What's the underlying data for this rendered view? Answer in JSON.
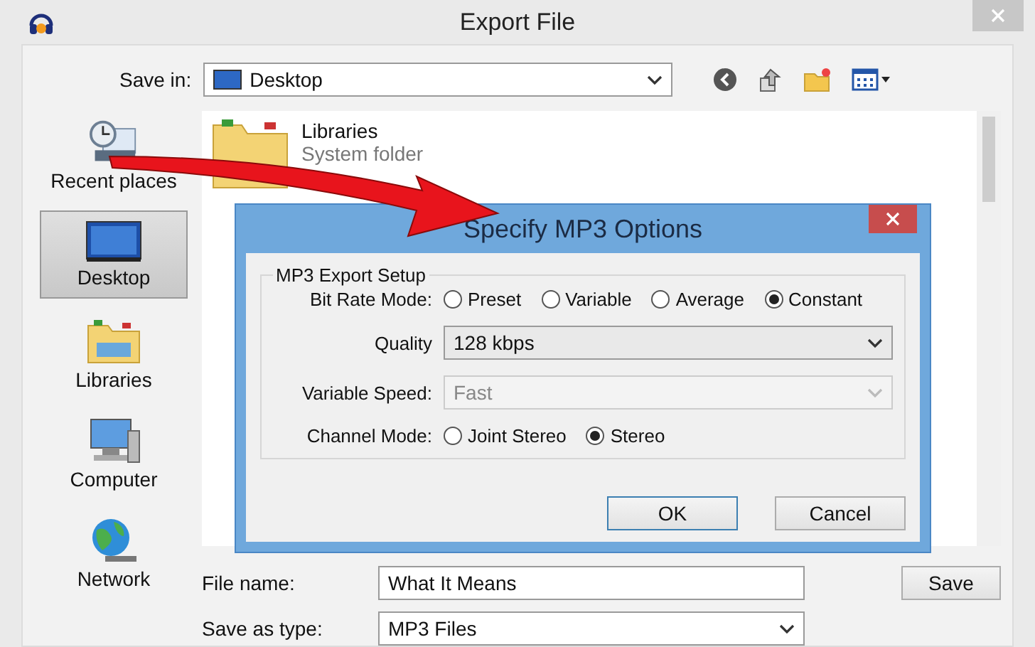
{
  "window": {
    "title": "Export File"
  },
  "save_in": {
    "label": "Save in:",
    "value": "Desktop"
  },
  "places": [
    {
      "label": "Recent places",
      "kind": "recent",
      "selected": false
    },
    {
      "label": "Desktop",
      "kind": "desktop",
      "selected": true
    },
    {
      "label": "Libraries",
      "kind": "libraries",
      "selected": false
    },
    {
      "label": "Computer",
      "kind": "computer",
      "selected": false
    },
    {
      "label": "Network",
      "kind": "network",
      "selected": false
    }
  ],
  "files": [
    {
      "name": "Libraries",
      "detail": "System folder"
    }
  ],
  "file_name": {
    "label": "File name:",
    "value": "What It Means"
  },
  "save_as_type": {
    "label": "Save as type:",
    "value": "MP3 Files"
  },
  "save_button": "Save",
  "dialog": {
    "title": "Specify MP3 Options",
    "group": "MP3 Export Setup",
    "bit_rate": {
      "label": "Bit Rate Mode:",
      "options": [
        {
          "label": "Preset",
          "selected": false
        },
        {
          "label": "Variable",
          "selected": false
        },
        {
          "label": "Average",
          "selected": false
        },
        {
          "label": "Constant",
          "selected": true
        }
      ]
    },
    "quality": {
      "label": "Quality",
      "value": "128 kbps",
      "disabled": false
    },
    "variable_speed": {
      "label": "Variable Speed:",
      "value": "Fast",
      "disabled": true
    },
    "channel_mode": {
      "label": "Channel Mode:",
      "options": [
        {
          "label": "Joint Stereo",
          "selected": false
        },
        {
          "label": "Stereo",
          "selected": true
        }
      ]
    },
    "buttons": [
      "OK",
      "Cancel"
    ]
  }
}
